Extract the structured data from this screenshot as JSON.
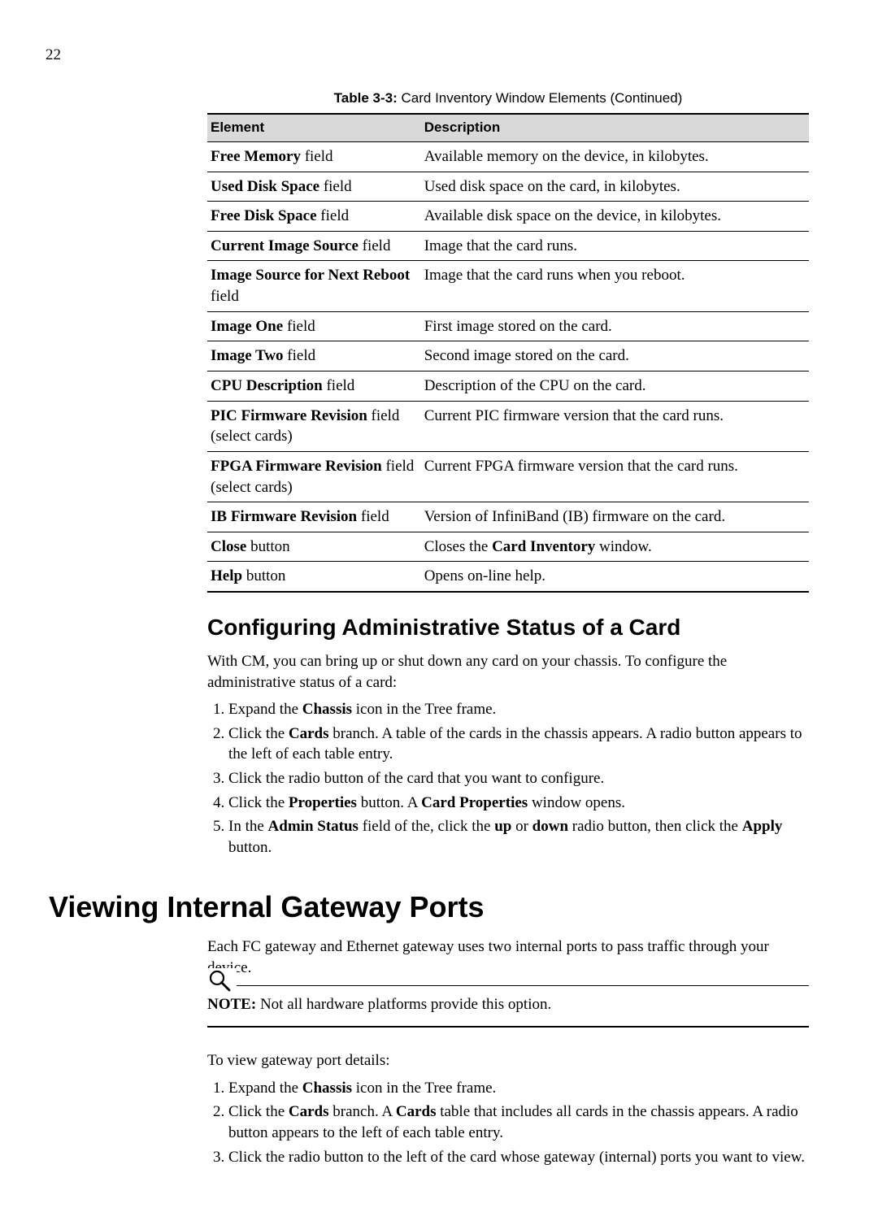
{
  "page_number": "22",
  "table": {
    "caption_label": "Table 3-3:",
    "caption_text": "Card Inventory Window Elements (Continued)",
    "head_element": "Element",
    "head_description": "Description",
    "rows": [
      {
        "e_bold": "Free Memory",
        "e_rest": " field",
        "d_pre": "Available memory on the device, in kilobytes."
      },
      {
        "e_bold": "Used Disk Space",
        "e_rest": " field",
        "d_pre": "Used disk space on the card, in kilobytes."
      },
      {
        "e_bold": "Free Disk Space",
        "e_rest": " field",
        "d_pre": "Available disk space on the device, in kilobytes."
      },
      {
        "e_bold": "Current Image Source",
        "e_rest": " field",
        "d_pre": "Image that the card runs."
      },
      {
        "e_bold": "Image Source for Next Reboot",
        "e_rest": " field",
        "d_pre": "Image that the card runs when you reboot."
      },
      {
        "e_bold": "Image One",
        "e_rest": " field",
        "d_pre": "First image stored on the card."
      },
      {
        "e_bold": "Image Two",
        "e_rest": " field",
        "d_pre": "Second image stored on the card."
      },
      {
        "e_bold": "CPU Description",
        "e_rest": " field",
        "d_pre": "Description of the CPU on the card."
      },
      {
        "e_bold": "PIC Firmware Revision",
        "e_rest": " field (select cards)",
        "d_pre": "Current PIC firmware version that the card runs."
      },
      {
        "e_bold": "FPGA Firmware Revision",
        "e_rest": " field (select cards)",
        "d_pre": "Current FPGA firmware version that the card runs."
      },
      {
        "e_bold": "IB Firmware Revision",
        "e_rest": " field",
        "d_pre": "Version of InfiniBand (IB) firmware on the card."
      },
      {
        "e_bold": "Close",
        "e_rest": " button",
        "d_pre": "Closes the ",
        "d_bold": "Card Inventory",
        "d_post": " window."
      },
      {
        "e_bold": "Help",
        "e_rest": " button",
        "d_pre": "Opens on-line help."
      }
    ]
  },
  "section1": {
    "heading": "Configuring Administrative Status of a Card",
    "intro": "With CM, you can bring up or shut down any card on your chassis. To configure the administrative status of a card:",
    "steps": {
      "s1_a": "Expand the ",
      "s1_b": "Chassis",
      "s1_c": " icon in the Tree frame.",
      "s2_a": "Click the ",
      "s2_b": "Cards",
      "s2_c": " branch. A table of the cards in the chassis appears. A radio button appears to the left of each table entry.",
      "s3_a": "Click the radio button of the card that you want to configure.",
      "s4_a": "Click the ",
      "s4_b": "Properties",
      "s4_c": " button. A ",
      "s4_d": "Card Properties",
      "s4_e": " window opens.",
      "s5_a": "In the ",
      "s5_b": "Admin Status",
      "s5_c": " field of the, click the ",
      "s5_d": "up",
      "s5_e": " or ",
      "s5_f": "down",
      "s5_g": " radio button, then click the ",
      "s5_h": "Apply",
      "s5_i": " button."
    }
  },
  "section2": {
    "heading": "Viewing Internal Gateway Ports",
    "intro": "Each FC gateway and Ethernet gateway uses two internal ports to pass traffic through your device.",
    "note_label": "NOTE:",
    "note_text": "  Not all hardware platforms provide this option.",
    "lead": "To view gateway port details:",
    "steps": {
      "s1_a": "Expand the ",
      "s1_b": "Chassis",
      "s1_c": " icon in the Tree frame.",
      "s2_a": "Click the ",
      "s2_b": "Cards",
      "s2_c": " branch. A ",
      "s2_d": "Cards",
      "s2_e": " table that includes all cards in the chassis appears. A radio button appears to the left of each table entry.",
      "s3_a": "Click the radio button to the left of the card whose gateway (internal) ports you want to view."
    }
  }
}
